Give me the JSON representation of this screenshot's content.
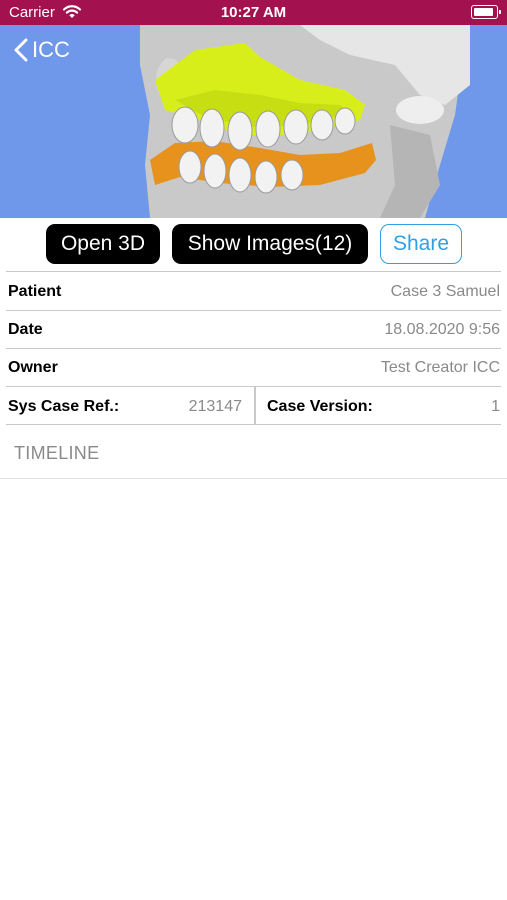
{
  "status_bar": {
    "carrier": "Carrier",
    "time": "10:27 AM"
  },
  "nav": {
    "back_label": "ICC"
  },
  "actions": {
    "open_3d": "Open 3D",
    "show_images": "Show Images(12)",
    "share": "Share"
  },
  "details": {
    "patient_label": "Patient",
    "patient_value": "Case 3 Samuel",
    "date_label": "Date",
    "date_value": "18.08.2020 9:56",
    "owner_label": "Owner",
    "owner_value": "Test Creator ICC",
    "sys_ref_label": "Sys Case Ref.:",
    "sys_ref_value": "213147",
    "version_label": "Case Version:",
    "version_value": "1"
  },
  "section": {
    "timeline": "TIMELINE"
  },
  "colors": {
    "status_bar": "#a3124f",
    "hero_bg": "#6f97ea",
    "accent": "#2f9fe6",
    "upper_model": "#d8ee1a",
    "lower_model": "#e6921d"
  },
  "icons": {
    "wifi": "wifi-icon",
    "battery": "battery-icon",
    "back": "chevron-left-icon"
  }
}
